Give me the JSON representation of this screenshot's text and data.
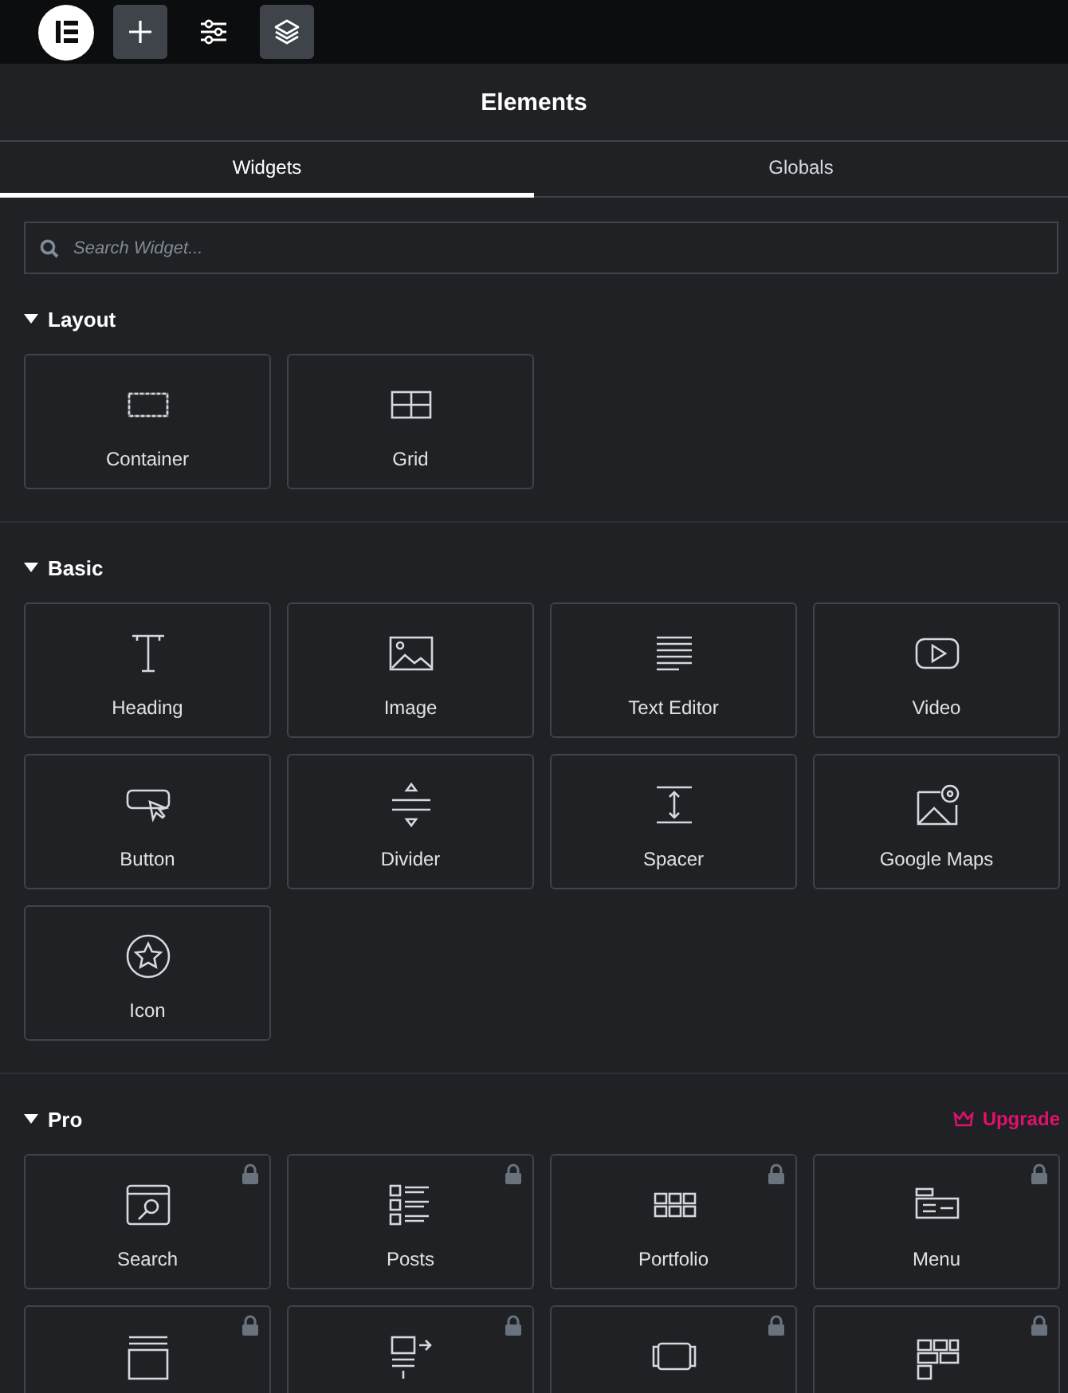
{
  "toolbar": {
    "buttons": [
      {
        "kind": "add",
        "selected": true
      },
      {
        "kind": "settings",
        "selected": false
      },
      {
        "kind": "layers",
        "selected": true
      }
    ]
  },
  "panel": {
    "title": "Elements"
  },
  "tabs": [
    {
      "label": "Widgets",
      "selected": true
    },
    {
      "label": "Globals",
      "selected": false
    }
  ],
  "search": {
    "placeholder": "Search Widget..."
  },
  "sections": [
    {
      "title": "Layout",
      "expanded": true,
      "widgets": [
        {
          "label": "Container",
          "locked": false
        },
        {
          "label": "Grid",
          "locked": false
        }
      ]
    },
    {
      "title": "Basic",
      "expanded": true,
      "widgets": [
        {
          "label": "Heading",
          "locked": false
        },
        {
          "label": "Image",
          "locked": false
        },
        {
          "label": "Text Editor",
          "locked": false
        },
        {
          "label": "Video",
          "locked": false
        },
        {
          "label": "Button",
          "locked": false
        },
        {
          "label": "Divider",
          "locked": false
        },
        {
          "label": "Spacer",
          "locked": false
        },
        {
          "label": "Google Maps",
          "locked": false
        },
        {
          "label": "Icon",
          "locked": false
        }
      ]
    },
    {
      "title": "Pro",
      "expanded": true,
      "upgrade": "Upgrade",
      "widgets": [
        {
          "label": "Search",
          "locked": true
        },
        {
          "label": "Posts",
          "locked": true
        },
        {
          "label": "Portfolio",
          "locked": true
        },
        {
          "label": "Menu",
          "locked": true
        },
        {
          "locked": true
        },
        {
          "locked": true
        },
        {
          "locked": true
        },
        {
          "locked": true
        }
      ]
    }
  ]
}
